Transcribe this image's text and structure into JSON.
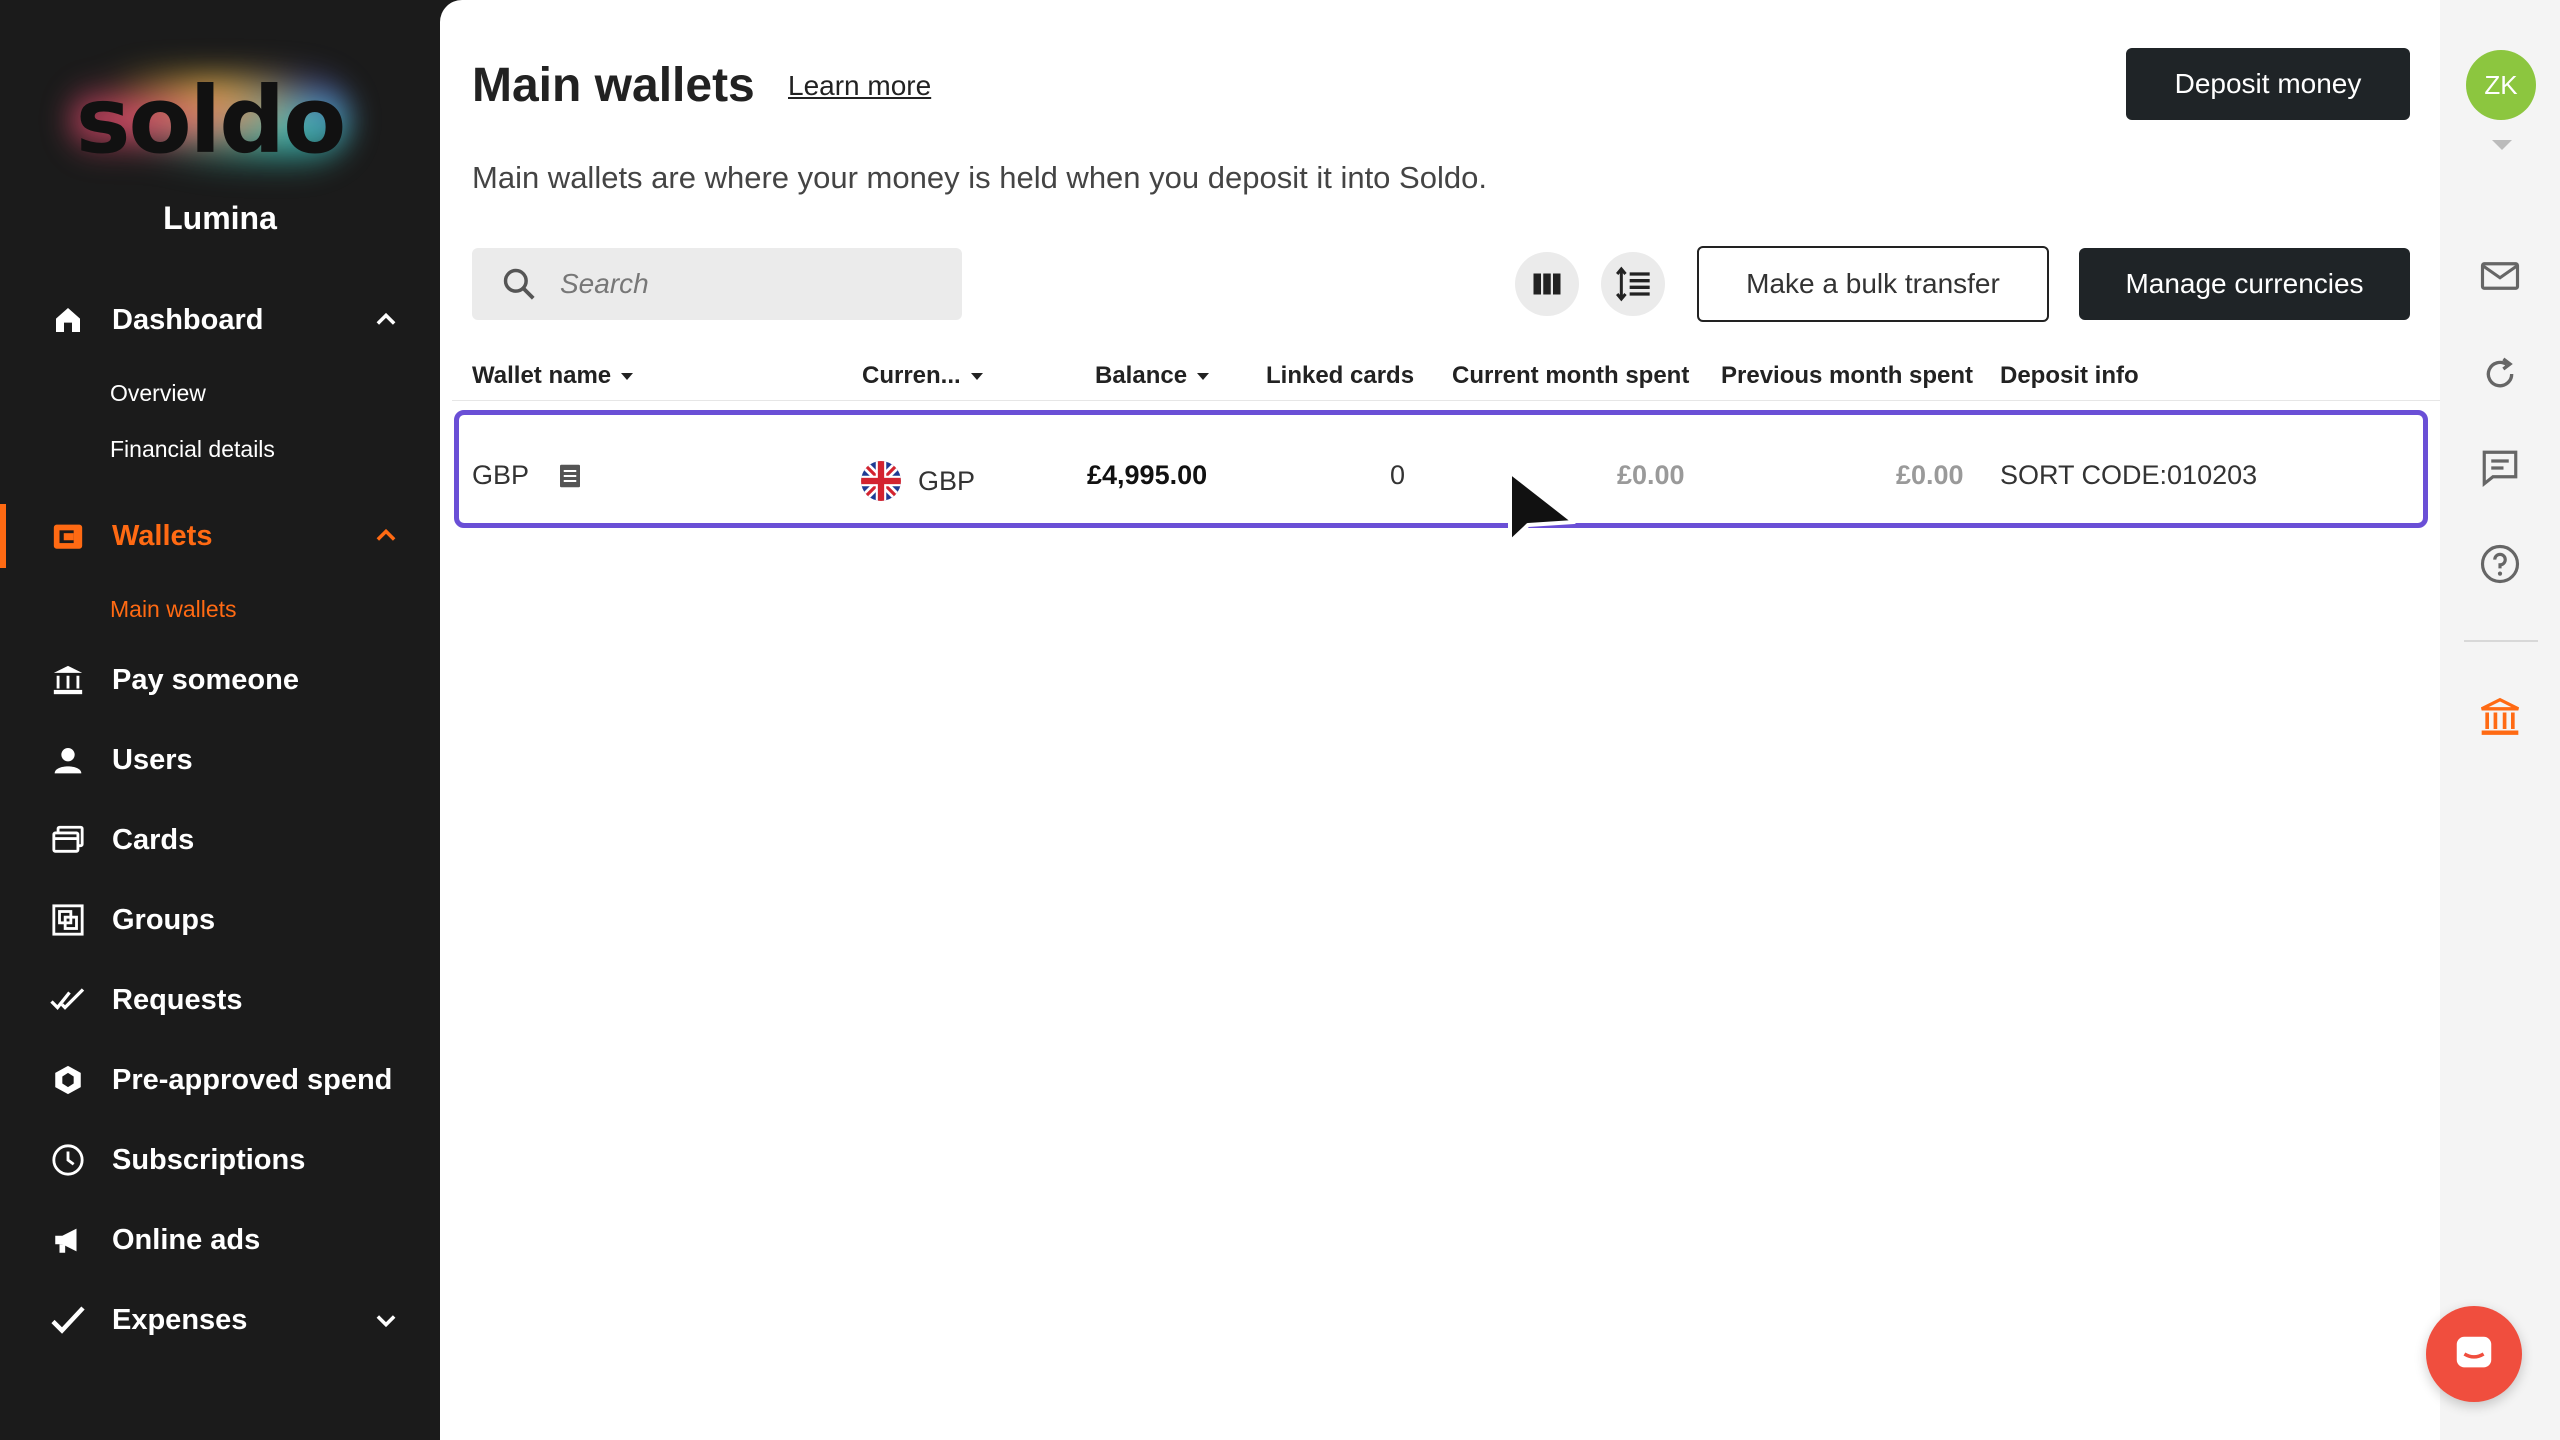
{
  "sidebar": {
    "logo_text": "soldo",
    "org_name": "Lumina",
    "items": [
      {
        "label": "Dashboard",
        "icon": "home-icon"
      },
      {
        "label": "Wallets",
        "icon": "wallet-icon"
      },
      {
        "label": "Pay someone",
        "icon": "bank-transfer-icon"
      },
      {
        "label": "Users",
        "icon": "user-icon"
      },
      {
        "label": "Cards",
        "icon": "cards-icon"
      },
      {
        "label": "Groups",
        "icon": "groups-icon"
      },
      {
        "label": "Requests",
        "icon": "double-check-icon"
      },
      {
        "label": "Pre-approved spend",
        "icon": "shield-icon"
      },
      {
        "label": "Subscriptions",
        "icon": "clock-icon"
      },
      {
        "label": "Online ads",
        "icon": "megaphone-icon"
      },
      {
        "label": "Expenses",
        "icon": "check-icon"
      }
    ],
    "dashboard_sub": [
      "Overview",
      "Financial details"
    ],
    "wallets_sub": [
      "Main wallets"
    ],
    "accent_color": "#ff6a13"
  },
  "header": {
    "title": "Main wallets",
    "learn_more": "Learn more",
    "deposit_label": "Deposit money",
    "description": "Main wallets are where your money is held when you deposit it into Soldo."
  },
  "toolbar": {
    "search_placeholder": "Search",
    "bulk_transfer_label": "Make a bulk transfer",
    "manage_currencies_label": "Manage currencies"
  },
  "table": {
    "columns": [
      "Wallet name",
      "Curren...",
      "Balance",
      "Linked cards",
      "Current month spent",
      "Previous month spent",
      "Deposit info"
    ],
    "rows": [
      {
        "wallet_name": "GBP",
        "currency": "GBP",
        "balance": "£4,995.00",
        "linked_cards": "0",
        "current_month_spent": "£0.00",
        "previous_month_spent": "£0.00",
        "deposit_info": "SORT CODE:010203"
      }
    ],
    "selected_row_color": "#6a4fd6"
  },
  "rail": {
    "avatar_initials": "ZK",
    "avatar_color": "#8cc63f"
  }
}
